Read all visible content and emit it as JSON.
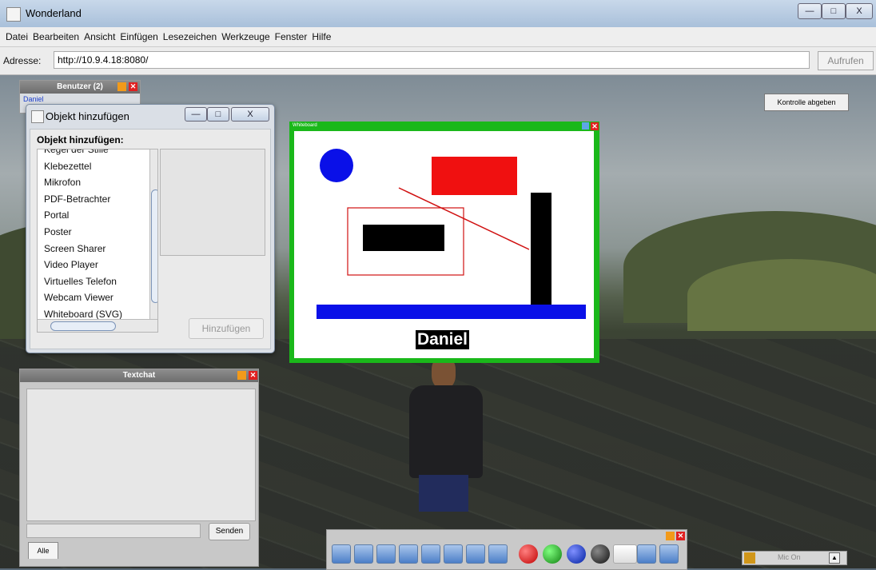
{
  "window": {
    "title": "Wonderland",
    "minimize": "—",
    "maximize": "□",
    "close": "X"
  },
  "menu": [
    "Datei",
    "Bearbeiten",
    "Ansicht",
    "Einfügen",
    "Lesezeichen",
    "Werkzeuge",
    "Fenster",
    "Hilfe"
  ],
  "address": {
    "label": "Adresse:",
    "value": "http://10.9.4.18:8080/",
    "go": "Aufrufen"
  },
  "users_panel": {
    "title": "Benutzer (2)",
    "first_user": "Daniel"
  },
  "control_button": "Kontrolle abgeben",
  "dialog": {
    "title": "Objekt hinzufügen",
    "header": "Objekt hinzufügen:",
    "items": [
      "Kegel der Stille",
      "Klebezettel",
      "Mikrofon",
      "PDF-Betrachter",
      "Portal",
      "Poster",
      "Screen Sharer",
      "Video Player",
      "Virtuelles Telefon",
      "Webcam Viewer",
      "Whiteboard (SVG)"
    ],
    "add_button": "Hinzufügen"
  },
  "whiteboard": {
    "title": "Whiteboard",
    "label": "Daniel"
  },
  "textchat": {
    "title": "Textchat",
    "send": "Senden",
    "tab": "Alle"
  },
  "mic": {
    "label": "Mic On"
  },
  "colors": {
    "whiteboard_frame": "#1ab81a",
    "circle": "#0a10e8",
    "rect": "#f01010",
    "bar": "#0a10e8"
  }
}
